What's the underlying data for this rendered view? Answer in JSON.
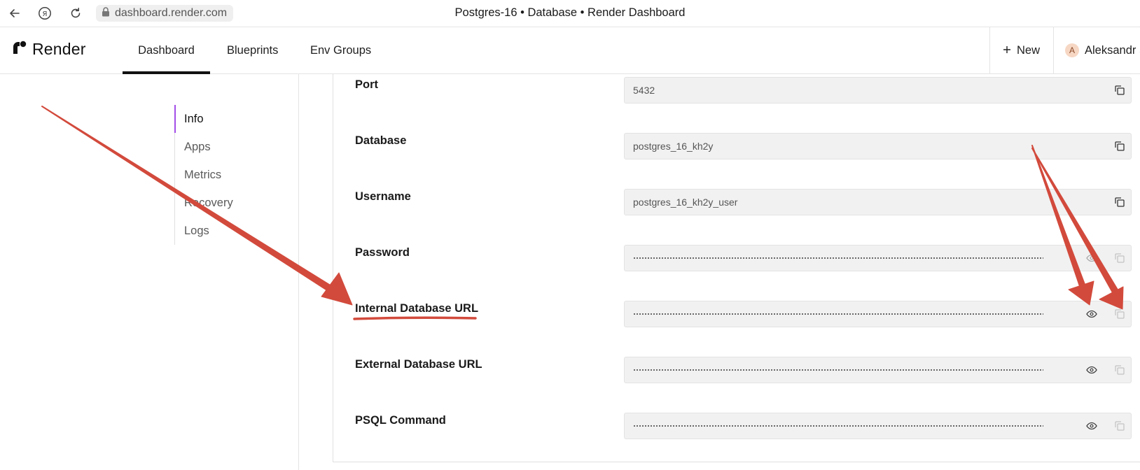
{
  "browser": {
    "url": "dashboard.render.com",
    "tab_title": "Postgres-16 • Database • Render Dashboard",
    "icons": [
      "back-arrow-icon",
      "yandex-icon",
      "reload-icon",
      "lock-icon"
    ]
  },
  "header": {
    "logo_text": "Render",
    "nav": [
      "Dashboard",
      "Blueprints",
      "Env Groups"
    ],
    "active_nav": "Dashboard",
    "new_label": "New",
    "user_initial": "A",
    "user_name": "Aleksandr S"
  },
  "subnav": {
    "items": [
      "Info",
      "Apps",
      "Metrics",
      "Recovery",
      "Logs"
    ],
    "active": "Info"
  },
  "fields": [
    {
      "label": "Port",
      "value": "5432",
      "masked": false
    },
    {
      "label": "Database",
      "value": "postgres_16_kh2y",
      "masked": false
    },
    {
      "label": "Username",
      "value": "postgres_16_kh2y_user",
      "masked": false
    },
    {
      "label": "Password",
      "value": "",
      "masked": true
    },
    {
      "label": "Internal Database URL",
      "value": "",
      "masked": true
    },
    {
      "label": "External Database URL",
      "value": "",
      "masked": true
    },
    {
      "label": "PSQL Command",
      "value": "",
      "masked": true
    }
  ],
  "colors": {
    "annotation": "#d24a3c",
    "subnav_active": "#a34ee8",
    "field_bg": "#f1f1f1"
  }
}
